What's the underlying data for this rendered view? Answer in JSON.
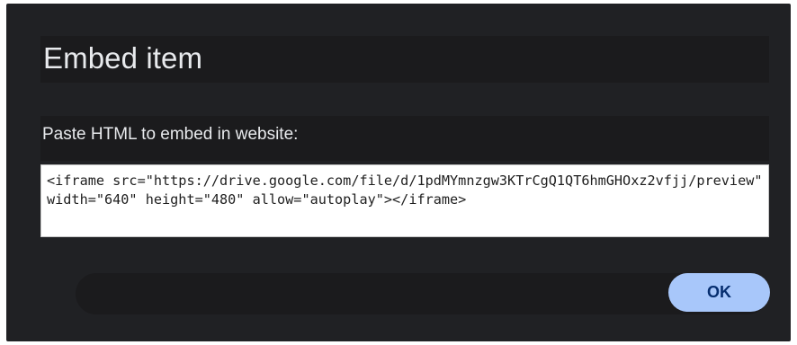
{
  "dialog": {
    "title": "Embed item",
    "prompt": "Paste HTML to embed in website:",
    "embed_code": "<iframe src=\"https://drive.google.com/file/d/1pdMYmnzgw3KTrCgQ1QT6hmGHOxz2vfjj/preview\" width=\"640\" height=\"480\" allow=\"autoplay\"></iframe>",
    "ok_label": "OK"
  },
  "colors": {
    "dialog_background": "#202124",
    "panel_background": "#1b1b1d",
    "ok_button": "#a8c7fa",
    "ok_text": "#062e6f"
  }
}
